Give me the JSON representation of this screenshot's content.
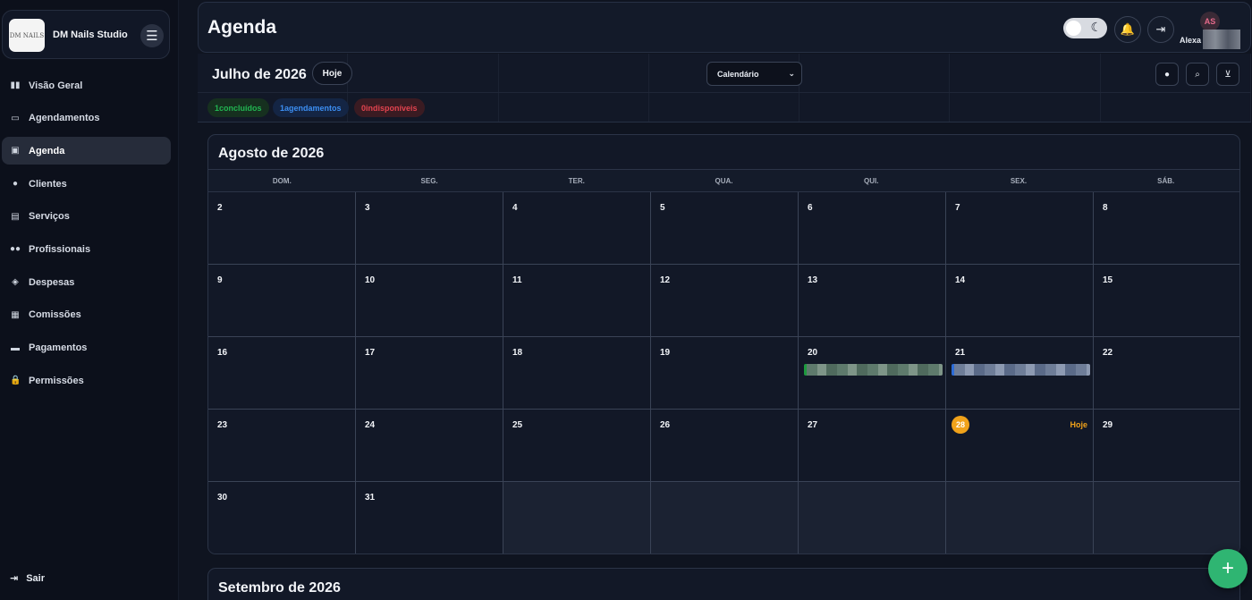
{
  "brand": {
    "name": "DM Nails Studio",
    "logo_text": "DM NAILS",
    "menu_icon": "hamburger-icon"
  },
  "sidebar": {
    "items": [
      {
        "label": "Visão Geral",
        "icon": "dashboard-icon",
        "glyph": "▮▮",
        "active": false
      },
      {
        "label": "Agendamentos",
        "icon": "calendar-icon",
        "glyph": "▭",
        "active": false
      },
      {
        "label": "Agenda",
        "icon": "calendar-today-icon",
        "glyph": "▣",
        "active": true
      },
      {
        "label": "Clientes",
        "icon": "person-icon",
        "glyph": "●",
        "active": false
      },
      {
        "label": "Serviços",
        "icon": "services-icon",
        "glyph": "▤",
        "active": false
      },
      {
        "label": "Profissionais",
        "icon": "people-icon",
        "glyph": "●●",
        "active": false
      },
      {
        "label": "Despesas",
        "icon": "expenses-icon",
        "glyph": "◈",
        "active": false
      },
      {
        "label": "Comissões",
        "icon": "receipt-icon",
        "glyph": "▦",
        "active": false
      },
      {
        "label": "Pagamentos",
        "icon": "payment-card-icon",
        "glyph": "▬",
        "active": false
      },
      {
        "label": "Permissões",
        "icon": "lock-icon",
        "glyph": "🔒",
        "active": false
      }
    ],
    "logout_label": "Sair"
  },
  "header": {
    "title": "Agenda",
    "user_initials": "AS",
    "user_name": "Alexa"
  },
  "toolbar": {
    "month_label": "Julho de 2026",
    "today_label": "Hoje",
    "view_select": "Calendário",
    "badges": [
      {
        "text": "1concluídos",
        "color": "#22b552"
      },
      {
        "text": "1agendamentos",
        "color": "#3c8ef2"
      },
      {
        "text": "0indisponíveis",
        "color": "#e2434f"
      }
    ]
  },
  "calendar": {
    "title": "Agosto de 2026",
    "weekdays": [
      "DOM.",
      "SEG.",
      "TER.",
      "QUA.",
      "QUI.",
      "SEX.",
      "SÁB."
    ],
    "weeks": [
      [
        "2",
        "3",
        "4",
        "5",
        "6",
        "7",
        "8"
      ],
      [
        "9",
        "10",
        "11",
        "12",
        "13",
        "14",
        "15"
      ],
      [
        "16",
        "17",
        "18",
        "19",
        "20",
        "21",
        "22"
      ],
      [
        "23",
        "24",
        "25",
        "26",
        "27",
        "28",
        "29"
      ],
      [
        "30",
        "31",
        "",
        "",
        "",
        "",
        ""
      ]
    ],
    "today_day": "28",
    "today_tag": "Hoje",
    "events": [
      {
        "day": "20",
        "status": "concluído",
        "color": "#1d9a3e"
      },
      {
        "day": "21",
        "status": "agendado",
        "color": "#2c6cd8"
      }
    ]
  },
  "next_month_title": "Setembro de 2026",
  "fab_label": "+",
  "colors": {
    "accent_today": "#f0a21a",
    "fab": "#2fb572"
  }
}
